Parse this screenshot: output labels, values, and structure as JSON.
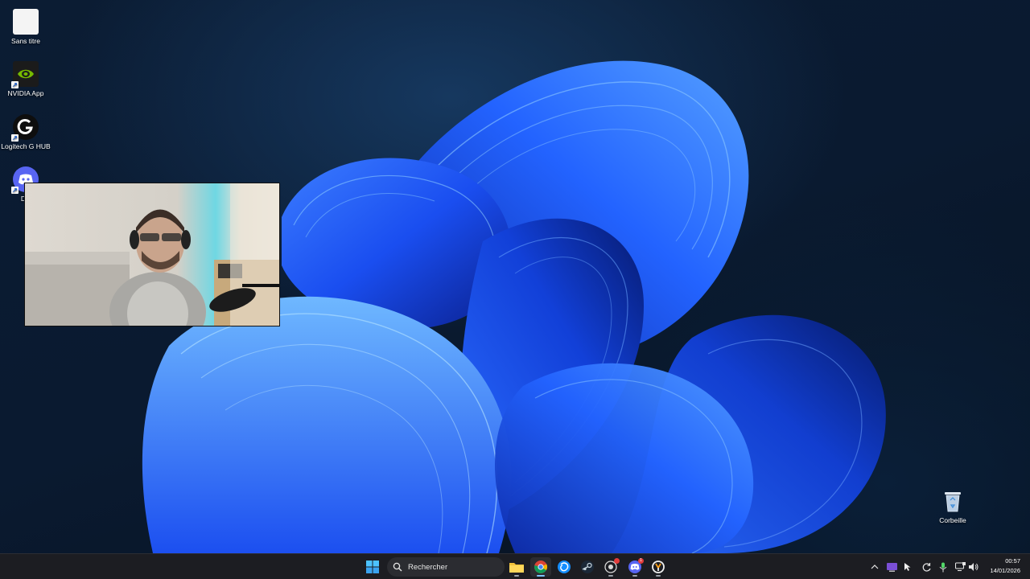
{
  "desktop": {
    "icons": [
      {
        "label": "Sans titre",
        "icon": "blank-document-icon"
      },
      {
        "label": "NVIDIA App",
        "icon": "nvidia-icon"
      },
      {
        "label": "Logitech G HUB",
        "icon": "logitech-g-icon"
      },
      {
        "label": "Discord",
        "visible_label": "Dis",
        "icon": "discord-icon"
      },
      {
        "label": "Corbeille",
        "icon": "recycle-bin-icon"
      }
    ],
    "wallpaper": "windows-11-bloom",
    "accent_color": "#1f5bff"
  },
  "webcam_overlay": {
    "content": "webcam-feed"
  },
  "taskbar": {
    "search_placeholder": "Rechercher",
    "pinned_apps": [
      "start-icon",
      "file-explorer-icon",
      "chrome-icon",
      "battlenet-icon",
      "steam-icon",
      "github-desktop-icon",
      "discord-icon",
      "overwatch-icon"
    ],
    "discord_badge": "1",
    "clock": {
      "time": "00:57",
      "date": "14/01/2026"
    }
  }
}
